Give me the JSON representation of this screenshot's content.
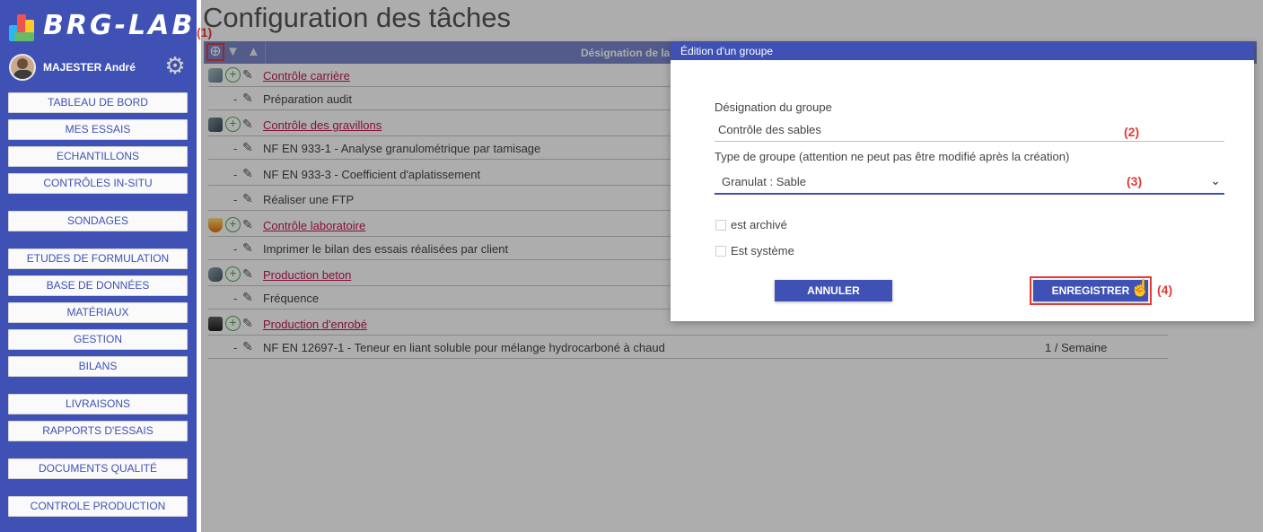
{
  "app": {
    "logo_text": "BRG-LAB",
    "colors": {
      "primary": "#3f51b5",
      "header": "#7986cb",
      "group_link": "#c2185b",
      "annotation": "#e53935",
      "add_icon": "#4caf50"
    }
  },
  "user": {
    "name": "MAJESTER André",
    "settings_icon": "gear-icon"
  },
  "sidebar": {
    "items": [
      {
        "label": "TABLEAU DE BORD"
      },
      {
        "label": "MES ESSAIS"
      },
      {
        "label": "ECHANTILLONS"
      },
      {
        "label": "CONTRÔLES IN-SITU"
      },
      {
        "label": "SONDAGES"
      },
      {
        "label": "ETUDES DE FORMULATION"
      },
      {
        "label": "BASE DE DONNÉES"
      },
      {
        "label": "MATÉRIAUX"
      },
      {
        "label": "GESTION"
      },
      {
        "label": "BILANS"
      },
      {
        "label": "LIVRAISONS"
      },
      {
        "label": "RAPPORTS D'ESSAIS"
      },
      {
        "label": "DOCUMENTS QUALITÉ"
      },
      {
        "label": "CONTROLE PRODUCTION"
      }
    ]
  },
  "page": {
    "title": "Configuration des tâches"
  },
  "grid": {
    "header": {
      "add_icon": "plus-circle-icon",
      "sort_down": "▼",
      "sort_up": "▲",
      "col_designation": "Désignation de la"
    },
    "rows": [
      {
        "type": "group",
        "label": "Contrôle carrière",
        "icon": "quarry-icon"
      },
      {
        "type": "task",
        "dash": "-",
        "label": "Préparation audit"
      },
      {
        "type": "group",
        "label": "Contrôle des gravillons",
        "icon": "gravel-icon"
      },
      {
        "type": "task",
        "dash": "-",
        "label": "NF EN 933-1 - Analyse granulométrique par tamisage"
      },
      {
        "type": "task",
        "dash": "-",
        "label": "NF EN 933-3 - Coefficient d'aplatissement"
      },
      {
        "type": "task",
        "dash": "-",
        "label": "Réaliser une FTP"
      },
      {
        "type": "group",
        "label": "Contrôle laboratoire",
        "icon": "flask-icon"
      },
      {
        "type": "task",
        "dash": "-",
        "label": "Imprimer le bilan des essais réalisées par client"
      },
      {
        "type": "group",
        "label": "Production beton",
        "icon": "concrete-mixer-icon"
      },
      {
        "type": "task",
        "dash": "-",
        "label": "Fréquence"
      },
      {
        "type": "group",
        "label": "Production d'enrobé",
        "icon": "asphalt-icon"
      },
      {
        "type": "task",
        "dash": "-",
        "label": "NF EN 12697-1 - Teneur en liant soluble pour mélange hydrocarboné à chaud",
        "frequency": "1 / Semaine"
      }
    ]
  },
  "dialog": {
    "title": "Édition d'un groupe",
    "designation_label": "Désignation du groupe",
    "designation_value": "Contrôle des sables",
    "type_label": "Type de groupe (attention ne peut pas être modifié après la création)",
    "type_value": "Granulat : Sable",
    "archived_label": "est archivé",
    "archived_checked": false,
    "system_label": "Est système",
    "system_checked": false,
    "cancel_label": "ANNULER",
    "save_label": "ENREGISTRER"
  },
  "annotations": {
    "a1": "(1)",
    "a2": "(2)",
    "a3": "(3)",
    "a4": "(4)"
  }
}
